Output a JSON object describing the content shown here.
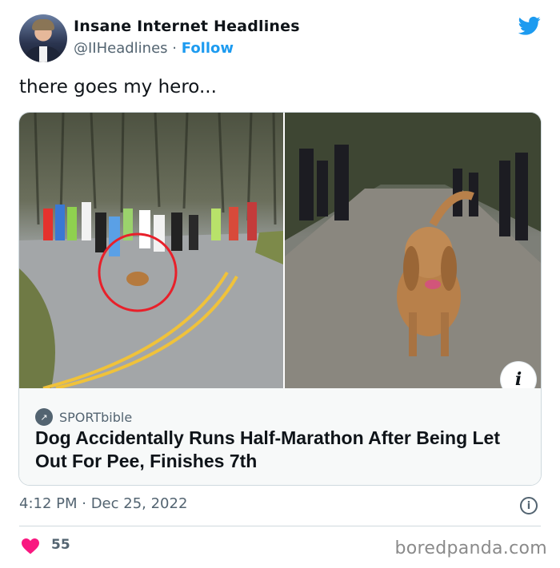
{
  "author": {
    "name": "Insane Internet Headlines",
    "handle": "@IIHeadlines",
    "separator": "·",
    "follow_label": "Follow"
  },
  "tweet": {
    "text": "there goes my hero...",
    "timestamp": "4:12 PM · Dec 25, 2022",
    "likes": "55"
  },
  "card": {
    "source": "SPORTbible",
    "headline": "Dog Accidentally Runs Half-Marathon After Being Let Out For Pee, Finishes 7th",
    "info_label": "i"
  },
  "info_icon_label": "i",
  "watermark": "boredpanda.com",
  "colors": {
    "accent": "#1d9bf0",
    "heart": "#f91880",
    "muted": "#536471",
    "highlight_circle": "#e8202a"
  },
  "icons": [
    "twitter-bird-icon",
    "info-icon",
    "heart-icon",
    "link-icon"
  ]
}
